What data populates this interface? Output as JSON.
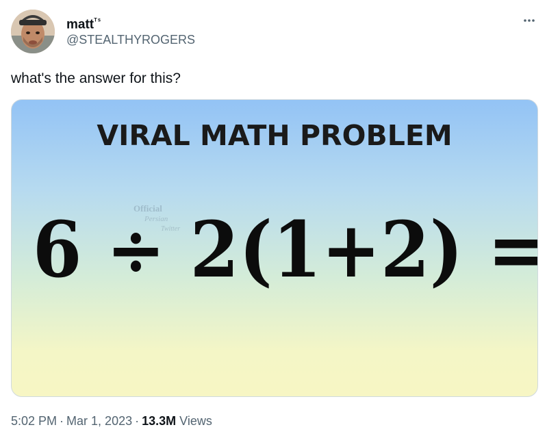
{
  "author": {
    "display_name": "matt",
    "display_name_suffix": "ᵀˢ",
    "handle": "@STEALTHYROGERS"
  },
  "tweet": {
    "text": "what's the answer for this?"
  },
  "media": {
    "title": "VIRAL MATH PROBLEM",
    "equation": "6 ÷ 2(1+2) =",
    "watermark": {
      "line1": "Official",
      "line2": "Persian",
      "line3": "Twitter"
    },
    "colors": {
      "gradient_top": "#93c3f5",
      "gradient_bottom": "#f7f6c4"
    }
  },
  "meta": {
    "time": "5:02 PM",
    "separator": "·",
    "date": "Mar 1, 2023",
    "views_count": "13.3M",
    "views_label": "Views"
  },
  "icons": {
    "more": "more-horizontal-icon"
  }
}
